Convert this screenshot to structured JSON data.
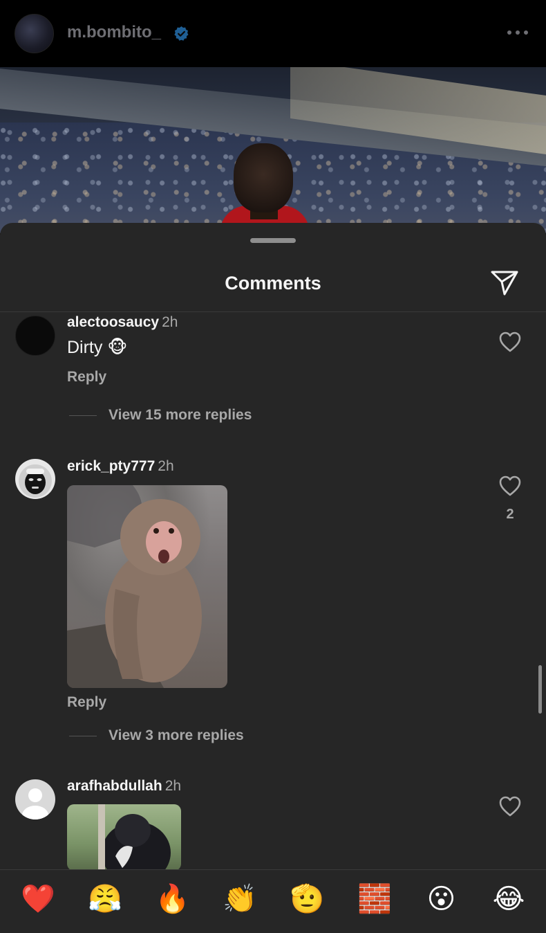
{
  "post": {
    "username": "m.bombito_"
  },
  "sheet": {
    "title": "Comments"
  },
  "comments": [
    {
      "username": "alectoosaucy",
      "time": "2h",
      "text": "Dirty 🐵",
      "reply_label": "Reply",
      "more_replies": "View 15 more replies"
    },
    {
      "username": "erick_pty777",
      "time": "2h",
      "likes": "2",
      "reply_label": "Reply",
      "more_replies": "View 3 more replies"
    },
    {
      "username": "arafhabdullah",
      "time": "2h"
    }
  ],
  "emoji_bar": [
    "❤️",
    "😤",
    "🔥",
    "👏",
    "🫡",
    "🧱",
    "😮",
    "😂"
  ]
}
